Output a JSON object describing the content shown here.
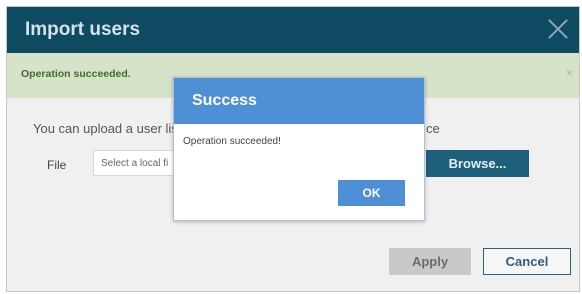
{
  "dialog": {
    "title": "Import users",
    "alert_text": "Operation succeeded.",
    "alert_close": "×",
    "description_start": "You can upload a user list",
    "description_end": "ce",
    "file_label": "File",
    "file_placeholder": "Select a local fi",
    "browse_label": "Browse...",
    "apply_label": "Apply",
    "cancel_label": "Cancel"
  },
  "modal": {
    "title": "Success",
    "message": "Operation succeeded!",
    "ok_label": "OK"
  },
  "colors": {
    "titlebar": "#0e4a62",
    "alert_bg": "#d6e3c9",
    "modal_accent": "#4e8fd6",
    "browse_bg": "#1e607c"
  }
}
